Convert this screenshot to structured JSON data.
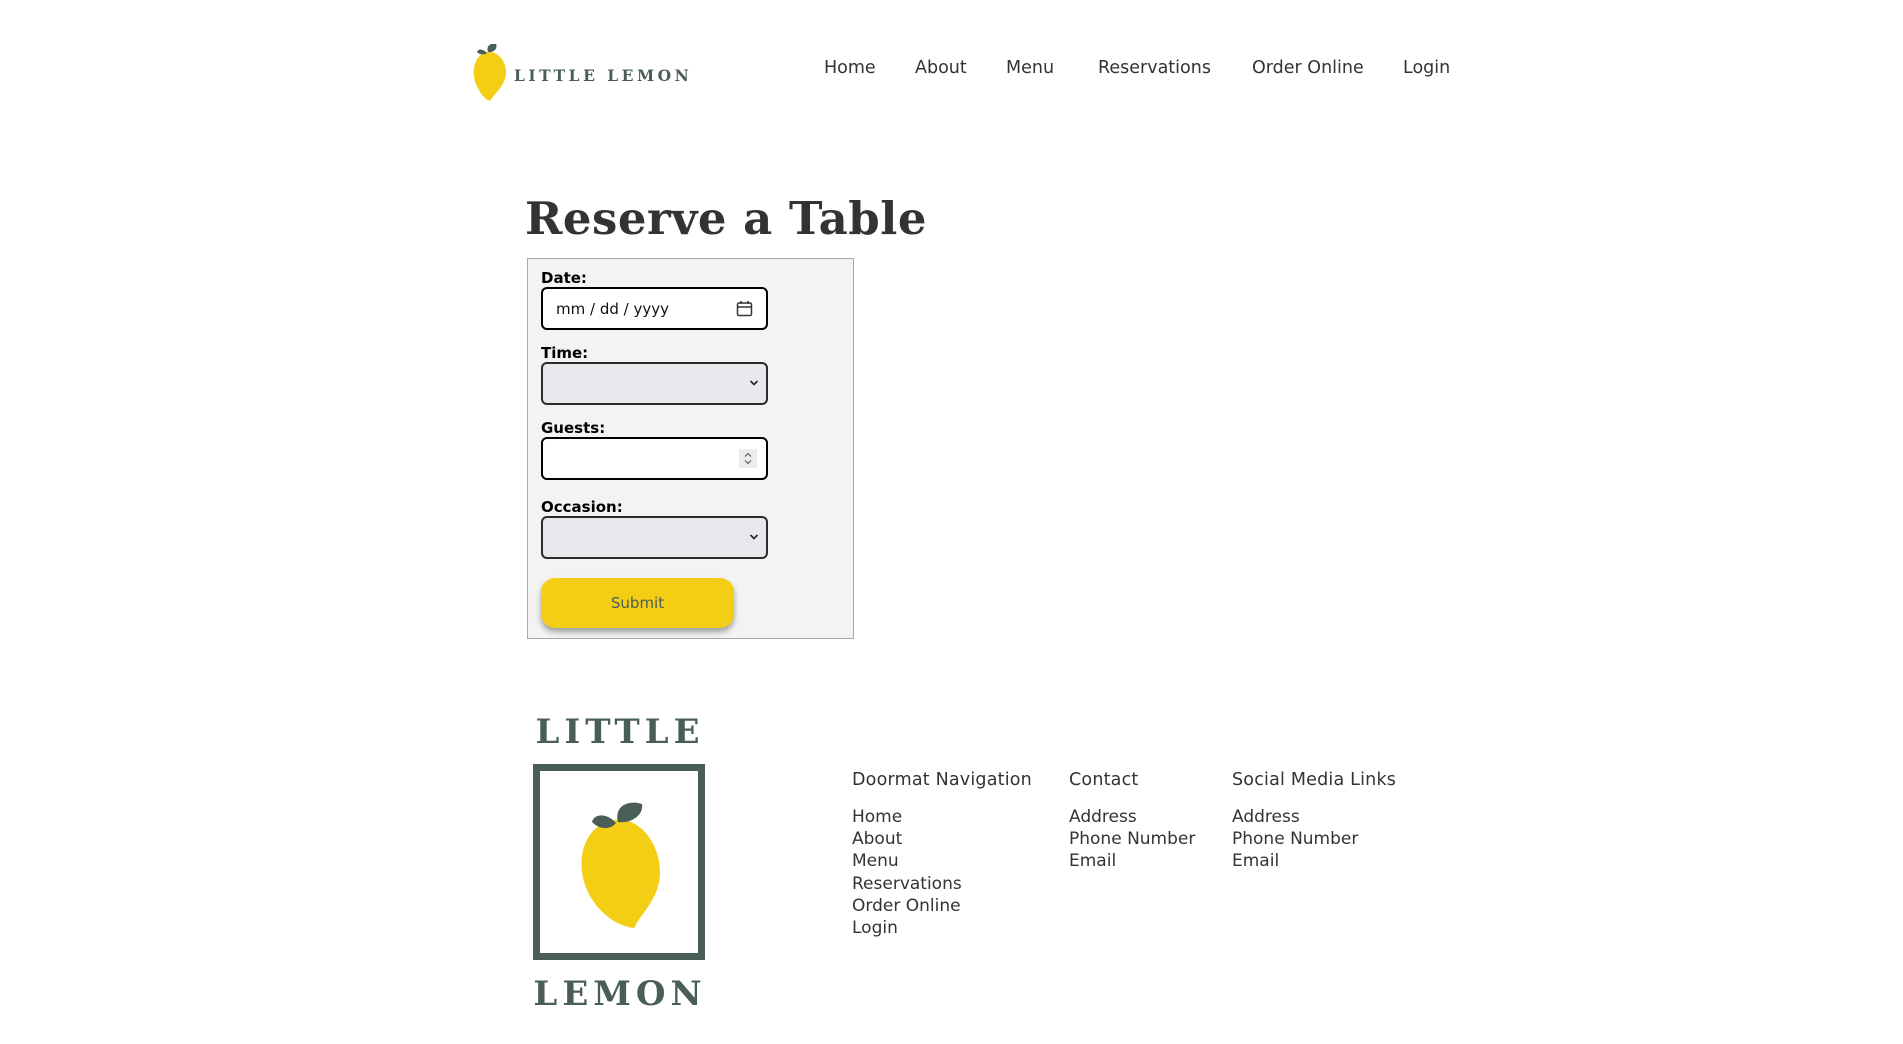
{
  "brand": {
    "name": "LITTLE LEMON",
    "footer_top": "LITTLE",
    "footer_bottom": "LEMON"
  },
  "nav": {
    "items": [
      {
        "label": "Home"
      },
      {
        "label": "About"
      },
      {
        "label": "Menu"
      },
      {
        "label": "Reservations"
      },
      {
        "label": "Order Online"
      },
      {
        "label": "Login"
      }
    ]
  },
  "reservation": {
    "title": "Reserve a Table",
    "date_label": "Date:",
    "date_placeholder": "mm / dd / yyyy",
    "time_label": "Time:",
    "time_value": "",
    "guests_label": "Guests:",
    "guests_value": "",
    "occasion_label": "Occasion:",
    "occasion_value": "",
    "submit_label": "Submit"
  },
  "footer": {
    "doormat": {
      "heading": "Doormat Navigation",
      "links": [
        "Home",
        "About",
        "Menu",
        "Reservations",
        "Order Online",
        "Login"
      ]
    },
    "contact": {
      "heading": "Contact",
      "links": [
        "Address",
        "Phone Number",
        "Email"
      ]
    },
    "social": {
      "heading": "Social Media Links",
      "links": [
        "Address",
        "Phone Number",
        "Email"
      ]
    }
  },
  "colors": {
    "primary_green": "#495e57",
    "primary_yellow": "#f4ce14",
    "form_background": "#f3f3f3"
  },
  "icons": [
    "lemon-logo-icon",
    "calendar-icon",
    "chevron-down-icon",
    "spinner-icon"
  ]
}
